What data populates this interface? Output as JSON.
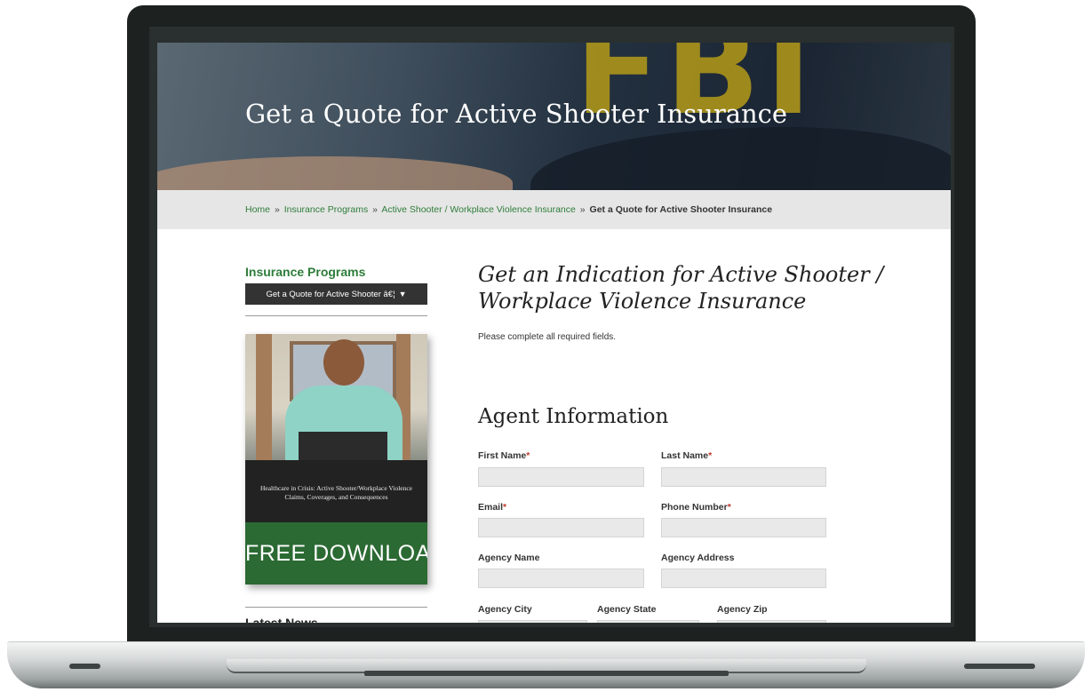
{
  "hero": {
    "title": "Get a Quote for Active Shooter Insurance"
  },
  "breadcrumb": {
    "items": [
      "Home",
      "Insurance Programs",
      "Active Shooter / Workplace Violence Insurance"
    ],
    "separator": "»",
    "current": "Get a Quote for Active Shooter Insurance"
  },
  "sidebar": {
    "title": "Insurance Programs",
    "select_value": "Get a Quote for Active Shooter â€¦",
    "promo": {
      "text": "Healthcare in Crisis: Active Shooter/Workplace Violence Claims, Coverages, and Consequences",
      "cta": "FREE DOWNLOAD"
    },
    "news_title": "Latest News"
  },
  "main": {
    "heading": "Get an Indication for Active Shooter / Workplace Violence Insurance",
    "intro": "Please complete all required fields.",
    "section_title": "Agent Information",
    "fields": {
      "first_name": {
        "label": "First Name",
        "required": "*"
      },
      "last_name": {
        "label": "Last Name",
        "required": "*"
      },
      "email": {
        "label": "Email",
        "required": "*"
      },
      "phone": {
        "label": "Phone Number",
        "required": "*"
      },
      "agency_name": {
        "label": "Agency Name"
      },
      "agency_address": {
        "label": "Agency Address"
      },
      "agency_city": {
        "label": "Agency City"
      },
      "agency_state": {
        "label": "Agency State"
      },
      "agency_zip": {
        "label": "Agency Zip"
      }
    }
  },
  "colors": {
    "accent_green": "#2e7d3a",
    "cta_green": "#2b6a33",
    "required_red": "#c0392b"
  }
}
